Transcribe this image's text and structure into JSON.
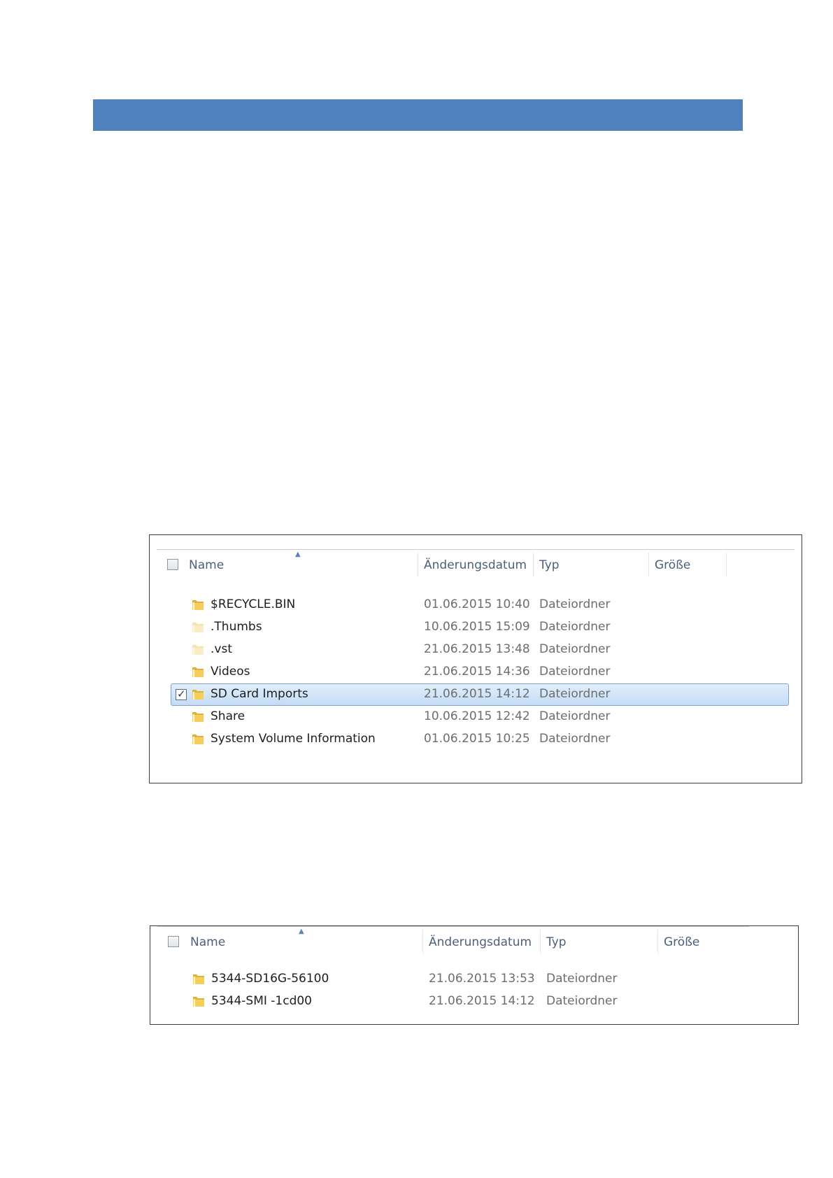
{
  "colors": {
    "banner": "#4f81bd",
    "selection": "#c4dcf7",
    "folder": "#f0c54a"
  },
  "explorer_1": {
    "headers": {
      "name": "Name",
      "date": "Änderungsdatum",
      "type": "Typ",
      "size": "Größe"
    },
    "sort_icon": "sort-ascending-icon",
    "rows": [
      {
        "name": "$RECYCLE.BIN",
        "date": "01.06.2015 10:40",
        "type": "Dateiordner",
        "icon": "folder-icon"
      },
      {
        "name": ".Thumbs",
        "date": "10.06.2015 15:09",
        "type": "Dateiordner",
        "icon": "folder-faded-icon"
      },
      {
        "name": ".vst",
        "date": "21.06.2015 13:48",
        "type": "Dateiordner",
        "icon": "folder-faded-icon"
      },
      {
        "name": "Videos",
        "date": "21.06.2015 14:36",
        "type": "Dateiordner",
        "icon": "folder-icon"
      },
      {
        "name": "SD Card Imports",
        "date": "21.06.2015 14:12",
        "type": "Dateiordner",
        "icon": "folder-icon",
        "selected": true,
        "checked": true
      },
      {
        "name": "Share",
        "date": "10.06.2015 12:42",
        "type": "Dateiordner",
        "icon": "folder-icon"
      },
      {
        "name": "System Volume Information",
        "date": "01.06.2015 10:25",
        "type": "Dateiordner",
        "icon": "folder-icon"
      }
    ]
  },
  "explorer_2": {
    "headers": {
      "name": "Name",
      "date": "Änderungsdatum",
      "type": "Typ",
      "size": "Größe"
    },
    "sort_icon": "sort-ascending-icon",
    "rows": [
      {
        "name": "5344-SD16G-56100",
        "date": "21.06.2015 13:53",
        "type": "Dateiordner",
        "icon": "folder-icon"
      },
      {
        "name": "5344-SMI  -1cd00",
        "date": "21.06.2015 14:12",
        "type": "Dateiordner",
        "icon": "folder-icon"
      }
    ]
  }
}
